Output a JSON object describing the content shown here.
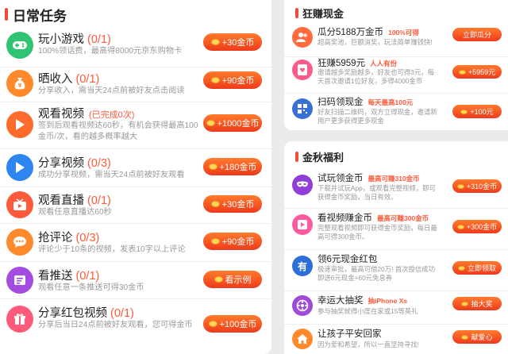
{
  "daily": {
    "title": "日常任务",
    "tasks": [
      {
        "title": "玩小游戏",
        "progress": "(0/1)",
        "desc": "100%领话费，最高得8000元京东购物卡",
        "button": "+30金币",
        "color": "#2ec473",
        "icon": "game"
      },
      {
        "title": "晒收入",
        "progress": "(0/1)",
        "desc": "分享收入，需当天24点前被好友点击阅读",
        "button": "+90金币",
        "color": "#ff8a2c",
        "icon": "money"
      },
      {
        "title": "观看视频",
        "progress": "(已完成0次)",
        "desc": "签到后观看视频达60秒，有机会获得最高100金币/次，看的越多概率越大",
        "button": "+1000金币",
        "color": "#ff6b2c",
        "icon": "play"
      },
      {
        "title": "分享视频",
        "progress": "(0/3)",
        "desc": "成功分享视频，需当天24点前被好友观看",
        "button": "+180金币",
        "color": "#2d86f0",
        "icon": "play"
      },
      {
        "title": "观看直播",
        "progress": "(0/1)",
        "desc": "观看任意直播达60秒",
        "button": "+30金币",
        "color": "#ff5a3a",
        "icon": "live"
      },
      {
        "title": "抢评论",
        "progress": "(0/3)",
        "desc": "评论少于10条的视频，发表10字以上评论",
        "button": "+90金币",
        "color": "#ff8a2c",
        "icon": "comment"
      },
      {
        "title": "看推送",
        "progress": "(0/1)",
        "desc": "观看任意一条推送可得30金币",
        "button": "看示例",
        "color": "#a24de0",
        "icon": "push"
      },
      {
        "title": "分享红包视频",
        "progress": "(0/1)",
        "desc": "分享后当日24点前被好友观看，您可得金币",
        "button": "+100金币",
        "color": "#ff5a7a",
        "icon": "gift"
      }
    ]
  },
  "cash": {
    "title": "狂赚现金",
    "tasks": [
      {
        "title": "瓜分5188万金币",
        "tag": "100%可得",
        "desc": "超高奖池，巨额消奖，玩法简单赚钱快!",
        "button": "立即瓜分",
        "color": "#ff6b3c",
        "icon": "people"
      },
      {
        "title": "狂赚5959元",
        "tag": "人人有份",
        "desc": "邀请越多奖励越多，好友也可得3元，每天首次邀请1位好友，多得4000金币",
        "button": "+5959元",
        "color": "#ff5a8a",
        "icon": "heart"
      },
      {
        "title": "扫码领现金",
        "tag": "每天最高100元",
        "desc": "好友扫描二维码，双方立得现金，邀请新用户更多获得更多现金",
        "button": "+100元",
        "color": "#3a6fd6",
        "icon": "qr"
      }
    ]
  },
  "autumn": {
    "title": "金秋福利",
    "tasks": [
      {
        "title": "试玩领金币",
        "tag": "最高可赚310金币",
        "desc": "下载并试玩App，或观看完整视频，即可获得金币奖励，当日有效。",
        "button": "+310金币",
        "color": "#8f3ed8",
        "icon": "mask"
      },
      {
        "title": "看视频赚金币",
        "tag": "最高可赚300金币",
        "desc": "完整观看视频即可获得金币奖励，每日最高可得300金币。",
        "button": "+300金币",
        "color": "#ff5aa0",
        "icon": "video"
      },
      {
        "title": "领6元现金红包",
        "tag": "",
        "desc": "极速审批，最高可借20万! 首次授信成功即送6元现金+60元免息券",
        "button": "立即领取",
        "color": "#2d6fd8",
        "icon": "you"
      },
      {
        "title": "幸运大抽奖",
        "tag": "抽iPhone Xs",
        "desc": "参与抽奖就得小度在家或15等英礼",
        "button": "抽大奖",
        "color": "#a04ad8",
        "icon": "lottery"
      },
      {
        "title": "让孩子平安回家",
        "tag": "",
        "desc": "因为爱和希望，所以一直坚持寻找!",
        "button": "献爱心",
        "color": "#ff8a2c",
        "icon": "home"
      }
    ]
  }
}
